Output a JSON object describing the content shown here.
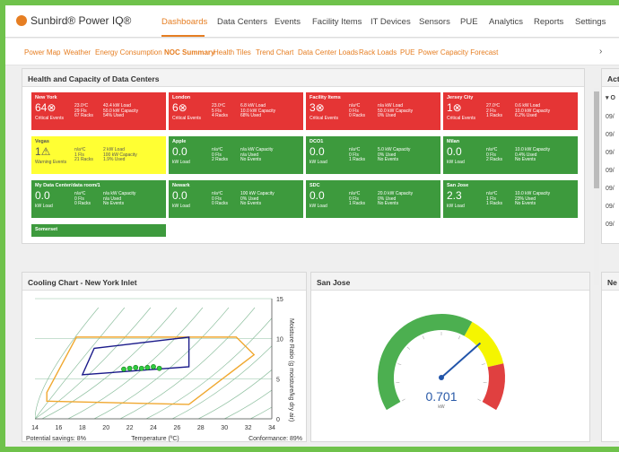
{
  "app": {
    "logo_text": "Sunbird® Power IQ®"
  },
  "nav": [
    {
      "label": "Dashboards",
      "active": true
    },
    {
      "label": "Data Centers"
    },
    {
      "label": "Events"
    },
    {
      "label": "Facility Items"
    },
    {
      "label": "IT Devices"
    },
    {
      "label": "Sensors"
    },
    {
      "label": "PUE"
    },
    {
      "label": "Analytics"
    },
    {
      "label": "Reports"
    },
    {
      "label": "Settings"
    }
  ],
  "subnav": [
    {
      "label": "Power Map"
    },
    {
      "label": "Weather"
    },
    {
      "label": "Energy Consumption"
    },
    {
      "label": "NOC Summary",
      "active": true
    },
    {
      "label": "Health Tiles"
    },
    {
      "label": "Trend Chart"
    },
    {
      "label": "Data Center Loads"
    },
    {
      "label": "Rack Loads"
    },
    {
      "label": "PUE"
    },
    {
      "label": "Power Capacity Forecast"
    }
  ],
  "subnav_arrow": "›",
  "health_panel": {
    "title": "Health and Capacity of Data Centers"
  },
  "datacenters": [
    {
      "name": "New York",
      "status": "red",
      "big": "64⊗",
      "sub1": "Critical Events",
      "col1": "23.0ºC\n29 Fls\n67 Racks",
      "col2": "43.4 kW Load\n50.0 kW Capacity\n54% Used"
    },
    {
      "name": "London",
      "status": "red",
      "big": "6⊗",
      "sub1": "Critical Events",
      "col1": "23.0ºC\n5 Fls\n4 Racks",
      "col2": "6.8 kW Load\n10.0 kW Capacity\n68% Used"
    },
    {
      "name": "Facility Items",
      "status": "red",
      "big": "3⊗",
      "sub1": "Critical Events",
      "col1": "n/aºC\n0 Fls\n0 Racks",
      "col2": "n/a kW Load\n50.0 kW Capacity\n0% Used"
    },
    {
      "name": "Jersey City",
      "status": "red",
      "big": "1⊗",
      "sub1": "Critical Events",
      "col1": "27.0ºC\n2 Fls\n1 Racks",
      "col2": "0.6 kW Load\n10.0 kW Capacity\n6.2% Used"
    },
    {
      "name": "Vegas",
      "status": "yellow",
      "big": "1⚠",
      "sub1": "Warning Events",
      "col1": "n/aºC\n1 Fls\n21 Racks",
      "col2": "2 kW Load\n100 kW Capacity\n1.9% Used"
    },
    {
      "name": "Apple",
      "status": "green",
      "big": "0.0",
      "sub1": "kW Load",
      "col1": "n/aºC\n0 Fls\n2 Racks",
      "col2": "n/a kW Capacity\nn/a Used\nNo Events"
    },
    {
      "name": "DCO1",
      "status": "green",
      "big": "0.0",
      "sub1": "kW Load",
      "col1": "n/aºC\n0 Fls\n1 Racks",
      "col2": "5.0 kW Capacity\n0% Used\nNo Events"
    },
    {
      "name": "Milan",
      "status": "green",
      "big": "0.0",
      "sub1": "kW Load",
      "col1": "n/aºC\n0 Fls\n2 Racks",
      "col2": "10.0 kW Capacity\n0.4% Used\nNo Events"
    },
    {
      "name": "My Data Center/data room/1",
      "status": "green",
      "big": "0.0",
      "sub1": "kW Load",
      "col1": "n/aºC\n0 Fls\n0 Racks",
      "col2": "n/a kW Capacity\nn/a Used\nNo Events"
    },
    {
      "name": "Newark",
      "status": "green",
      "big": "0.0",
      "sub1": "kW Load",
      "col1": "n/aºC\n0 Fls\n0 Racks",
      "col2": "100 kW Capacity\n0% Used\nNo Events"
    },
    {
      "name": "SDC",
      "status": "green",
      "big": "0.0",
      "sub1": "kW Load",
      "col1": "n/aºC\n0 Fls\n1 Racks",
      "col2": "20.0 kW Capacity\n0% Used\nNo Events"
    },
    {
      "name": "San Jose",
      "status": "green",
      "big": "2.3",
      "sub1": "kW Load",
      "col1": "n/aºC\n1 Fls\n1 Racks",
      "col2": "10.0 kW Capacity\n23% Used\nNo Events"
    },
    {
      "name": "Somerset",
      "status": "green",
      "big": "",
      "sub1": "",
      "col1": "",
      "col2": ""
    }
  ],
  "activity_panel": {
    "title": "Act",
    "group": "▾ O",
    "rows": [
      "09/",
      "09/",
      "09/",
      "09/",
      "09/",
      "09/",
      "09/"
    ]
  },
  "cooling": {
    "title": "Cooling Chart - New York Inlet",
    "xlabel": "Temperature (ºC)",
    "ylabel": "Moisture Ratio (g moisture/kg dry air)",
    "x_ticks": [
      "14",
      "16",
      "18",
      "20",
      "22",
      "24",
      "26",
      "28",
      "30",
      "32",
      "34"
    ],
    "y_ticks": [
      "0",
      "5",
      "10",
      "15"
    ],
    "potential": "Potential savings: 8%",
    "conformance": "Conformance: 89%",
    "colors": {
      "recommended": "#1a1a8a",
      "allowable": "#f0a830",
      "grid": "#8fc0a0",
      "points": "#2ecc40"
    }
  },
  "chart_data": {
    "type": "scatter",
    "title": "Cooling Chart - New York Inlet",
    "xlabel": "Temperature (ºC)",
    "ylabel": "Moisture Ratio (g moisture/kg dry air)",
    "xlim": [
      14,
      34
    ],
    "ylim": [
      0,
      15
    ],
    "series": [
      {
        "values": [
          [
            21.5,
            6.2
          ],
          [
            22.0,
            6.3
          ],
          [
            22.5,
            6.4
          ],
          [
            23.0,
            6.3
          ],
          [
            23.5,
            6.4
          ],
          [
            24.0,
            6.5
          ],
          [
            24.5,
            6.3
          ]
        ]
      }
    ],
    "legend": "none",
    "grid": true
  },
  "gauge": {
    "title": "San Jose",
    "value": "0.701",
    "unit": "kW",
    "level": 0.701,
    "max": 1.0,
    "colors": {
      "green": "#4caf50",
      "yellow": "#f5f500",
      "red": "#e04040",
      "needle": "#2255aa"
    }
  },
  "right_panel": {
    "title": "Ne"
  }
}
